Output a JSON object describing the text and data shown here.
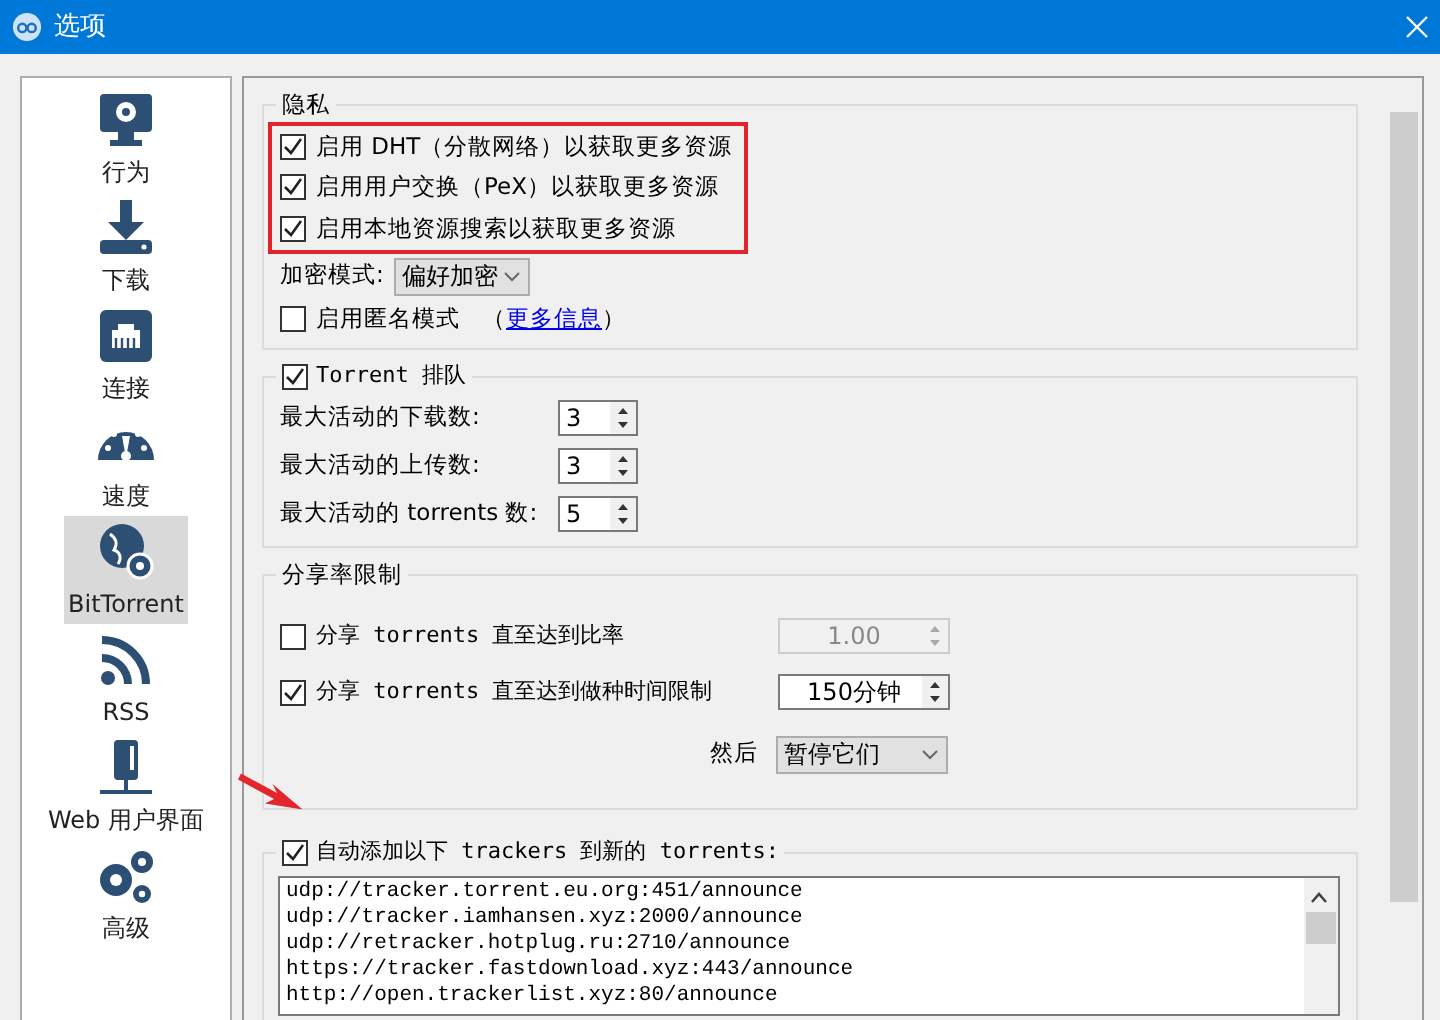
{
  "window": {
    "title": "选项"
  },
  "sidebar": {
    "items": [
      {
        "label": "行为",
        "kind": "monitor",
        "selected": false
      },
      {
        "label": "下载",
        "kind": "download",
        "selected": false
      },
      {
        "label": "连接",
        "kind": "network",
        "selected": false
      },
      {
        "label": "速度",
        "kind": "speed",
        "selected": false
      },
      {
        "label": "BitTorrent",
        "kind": "globe",
        "selected": true
      },
      {
        "label": "RSS",
        "kind": "rss",
        "selected": false
      },
      {
        "label": "Web 用户界面",
        "kind": "server",
        "selected": false
      },
      {
        "label": "高级",
        "kind": "gears",
        "selected": false
      }
    ]
  },
  "privacy": {
    "title": "隐私",
    "options": [
      {
        "label": "启用 DHT（分散网络）以获取更多资源",
        "checked": true
      },
      {
        "label": "启用用户交换（PeX）以获取更多资源",
        "checked": true
      },
      {
        "label": "启用本地资源搜索以获取更多资源",
        "checked": true
      }
    ],
    "encryption": {
      "label": "加密模式:",
      "value": "偏好加密"
    },
    "anonymous": {
      "label": "启用匿名模式",
      "checked": false,
      "note_open": "（",
      "link": "更多信息",
      "note_close": "）"
    }
  },
  "queue": {
    "title": "Torrent 排队",
    "checked": true,
    "limits": [
      {
        "label": "最大活动的下载数:",
        "value": "3"
      },
      {
        "label": "最大活动的上传数:",
        "value": "3"
      },
      {
        "label": "最大活动的 torrents 数:",
        "value": "5"
      }
    ]
  },
  "ratio": {
    "title": "分享率限制",
    "rules": [
      {
        "label": "分享 torrents 直至达到比率",
        "checked": false,
        "value": "1.00",
        "disabled": true
      },
      {
        "label": "分享 torrents 直至达到做种时间限制",
        "checked": true,
        "value": "150分钟",
        "disabled": false
      }
    ],
    "action": {
      "label": "然后",
      "value": "暂停它们"
    }
  },
  "trackers": {
    "title": "自动添加以下 trackers 到新的 torrents:",
    "checked": true,
    "list": [
      "udp://tracker.torrent.eu.org:451/announce",
      "udp://tracker.iamhansen.xyz:2000/announce",
      "udp://retracker.hotplug.ru:2710/announce",
      "https://tracker.fastdownload.xyz:443/announce",
      "http://open.trackerlist.xyz:80/announce"
    ]
  }
}
